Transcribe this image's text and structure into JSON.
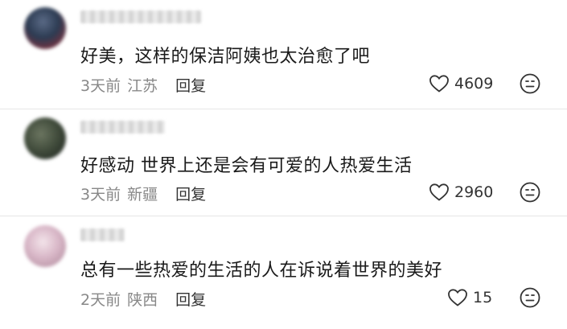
{
  "comments": [
    {
      "text": "好美，这样的保洁阿姨也太治愈了吧",
      "time": "3天前",
      "location": "江苏",
      "reply_label": "回复",
      "likes": "4609",
      "avatar_color": "#2c3b52"
    },
    {
      "text": "好感动 世界上还是会有可爱的人热爱生活",
      "time": "3天前",
      "location": "新疆",
      "reply_label": "回复",
      "likes": "2960",
      "avatar_color": "#3f4a3a"
    },
    {
      "text": "总有一些热爱的生活的人在诉说着世界的美好",
      "time": "2天前",
      "location": "陕西",
      "reply_label": "回复",
      "likes": "15",
      "avatar_color": "#d9b8c8"
    }
  ],
  "colors": {
    "text": "#1a1a1a",
    "meta": "#888888",
    "divider": "#e6e6e6"
  },
  "icons": {
    "like": "heart-outline-icon",
    "emoji": "smiley-face-icon"
  }
}
